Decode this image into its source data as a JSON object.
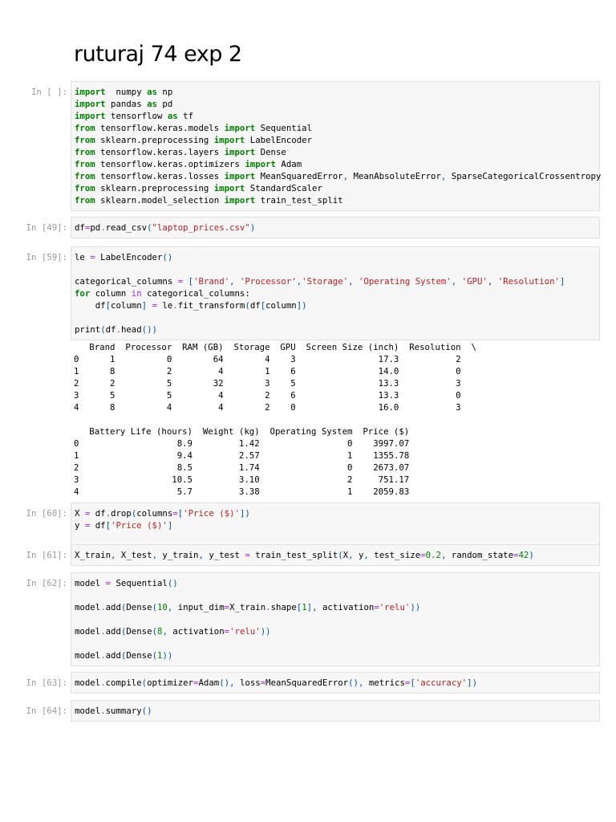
{
  "title": "ruturaj 74 exp 2",
  "cells": [
    {
      "prompt": "In [ ]:",
      "code": [
        [
          [
            "k",
            "import"
          ],
          [
            "",
            "  numpy "
          ],
          [
            "k",
            "as"
          ],
          [
            "",
            " np"
          ]
        ],
        [
          [
            "k",
            "import"
          ],
          [
            "",
            " pandas "
          ],
          [
            "k",
            "as"
          ],
          [
            "",
            " pd"
          ]
        ],
        [
          [
            "k",
            "import"
          ],
          [
            "",
            " tensorflow "
          ],
          [
            "k",
            "as"
          ],
          [
            "",
            " tf"
          ]
        ],
        [
          [
            "k",
            "from"
          ],
          [
            "",
            " tensorflow.keras.models "
          ],
          [
            "k",
            "import"
          ],
          [
            "",
            " Sequential"
          ]
        ],
        [
          [
            "k",
            "from"
          ],
          [
            "",
            " sklearn.preprocessing "
          ],
          [
            "k",
            "import"
          ],
          [
            "",
            " LabelEncoder"
          ]
        ],
        [
          [
            "k",
            "from"
          ],
          [
            "",
            " tensorflow.keras.layers "
          ],
          [
            "k",
            "import"
          ],
          [
            "",
            " Dense"
          ]
        ],
        [
          [
            "k",
            "from"
          ],
          [
            "",
            " tensorflow.keras.optimizers "
          ],
          [
            "k",
            "import"
          ],
          [
            "",
            " Adam"
          ]
        ],
        [
          [
            "k",
            "from"
          ],
          [
            "",
            " tensorflow.keras.losses "
          ],
          [
            "k",
            "import"
          ],
          [
            "",
            " MeanSquaredError"
          ],
          [
            "p",
            ","
          ],
          [
            "",
            " MeanAbsoluteError"
          ],
          [
            "p",
            ","
          ],
          [
            "",
            " SparseCategoricalCrossentropy"
          ]
        ],
        [
          [
            "k",
            "from"
          ],
          [
            "",
            " sklearn.preprocessing "
          ],
          [
            "k",
            "import"
          ],
          [
            "",
            " StandardScaler"
          ]
        ],
        [
          [
            "k",
            "from"
          ],
          [
            "",
            " sklearn.model_selection "
          ],
          [
            "k",
            "import"
          ],
          [
            "",
            " train_test_split"
          ]
        ]
      ]
    },
    {
      "prompt": "In [49]:",
      "code": [
        [
          [
            "",
            "df"
          ],
          [
            "o",
            "="
          ],
          [
            "",
            "pd"
          ],
          [
            "o",
            "."
          ],
          [
            "",
            "read_csv"
          ],
          [
            "p",
            "("
          ],
          [
            "s",
            "\"laptop_prices.csv\""
          ],
          [
            "p",
            ")"
          ]
        ]
      ]
    },
    {
      "prompt": "In [59]:",
      "code": [
        [
          [
            "",
            "le "
          ],
          [
            "o",
            "="
          ],
          [
            "",
            " LabelEncoder"
          ],
          [
            "p",
            "()"
          ]
        ],
        [],
        [
          [
            "",
            "categorical_columns "
          ],
          [
            "o",
            "="
          ],
          [
            "p",
            " ["
          ],
          [
            "s",
            "'Brand'"
          ],
          [
            "p",
            ", "
          ],
          [
            "s",
            "'Processor'"
          ],
          [
            "p",
            ","
          ],
          [
            "s",
            "'Storage'"
          ],
          [
            "p",
            ", "
          ],
          [
            "s",
            "'Operating System'"
          ],
          [
            "p",
            ", "
          ],
          [
            "s",
            "'GPU'"
          ],
          [
            "p",
            ", "
          ],
          [
            "s",
            "'Resolution'"
          ],
          [
            "p",
            "]"
          ]
        ],
        [
          [
            "k",
            "for"
          ],
          [
            "",
            " column "
          ],
          [
            "o",
            "in"
          ],
          [
            "",
            " categorical_columns:"
          ]
        ],
        [
          [
            "",
            "    df"
          ],
          [
            "p",
            "["
          ],
          [
            "",
            "column"
          ],
          [
            "p",
            "]"
          ],
          [
            "o",
            " ="
          ],
          [
            "",
            " le"
          ],
          [
            "o",
            "."
          ],
          [
            "",
            "fit_transform"
          ],
          [
            "p",
            "("
          ],
          [
            "",
            "df"
          ],
          [
            "p",
            "["
          ],
          [
            "",
            "column"
          ],
          [
            "p",
            "])"
          ]
        ],
        [],
        [
          [
            "",
            "print"
          ],
          [
            "p",
            "("
          ],
          [
            "",
            "df"
          ],
          [
            "o",
            "."
          ],
          [
            "",
            "head"
          ],
          [
            "p",
            "())"
          ]
        ]
      ],
      "output": [
        "   Brand  Processor  RAM (GB)  Storage  GPU  Screen Size (inch)  Resolution  \\",
        "0      1          0        64        4    3                17.3           2",
        "1      8          2         4        1    6                14.0           0",
        "2      2          5        32        3    5                13.3           3",
        "3      5          5         4        2    6                13.3           0",
        "4      8          4         4        2    0                16.0           3",
        "",
        "   Battery Life (hours)  Weight (kg)  Operating System  Price ($)",
        "0                   8.9         1.42                 0    3997.07",
        "1                   9.4         2.57                 1    1355.78",
        "2                   8.5         1.74                 0    2673.07",
        "3                  10.5         3.10                 2     751.17",
        "4                   5.7         3.38                 1    2059.83"
      ]
    },
    {
      "prompt": "In [60]:",
      "code": [
        [
          [
            "",
            "X "
          ],
          [
            "o",
            "="
          ],
          [
            "",
            " df"
          ],
          [
            "o",
            "."
          ],
          [
            "",
            "drop"
          ],
          [
            "p",
            "("
          ],
          [
            "",
            "columns"
          ],
          [
            "o",
            "="
          ],
          [
            "p",
            "["
          ],
          [
            "s",
            "'Price ($)'"
          ],
          [
            "p",
            "])"
          ]
        ],
        [
          [
            "",
            "y "
          ],
          [
            "o",
            "="
          ],
          [
            "",
            " df"
          ],
          [
            "p",
            "["
          ],
          [
            "s",
            "'Price ($)'"
          ],
          [
            "p",
            "]"
          ]
        ],
        []
      ]
    },
    {
      "prompt": "In [61]:",
      "code": [
        [
          [
            "",
            "X_train"
          ],
          [
            "p",
            ","
          ],
          [
            "",
            " X_test"
          ],
          [
            "p",
            ","
          ],
          [
            "",
            " y_train"
          ],
          [
            "p",
            ","
          ],
          [
            "",
            " y_test "
          ],
          [
            "o",
            "="
          ],
          [
            "",
            " train_test_split"
          ],
          [
            "p",
            "("
          ],
          [
            "",
            "X"
          ],
          [
            "p",
            ","
          ],
          [
            "",
            " y"
          ],
          [
            "p",
            ","
          ],
          [
            "",
            " test_size"
          ],
          [
            "o",
            "="
          ],
          [
            "n",
            "0.2"
          ],
          [
            "p",
            ","
          ],
          [
            "",
            " random_state"
          ],
          [
            "o",
            "="
          ],
          [
            "n",
            "42"
          ],
          [
            "p",
            ")"
          ]
        ]
      ]
    },
    {
      "prompt": "In [62]:",
      "code": [
        [
          [
            "",
            "model "
          ],
          [
            "o",
            "="
          ],
          [
            "",
            " Sequential"
          ],
          [
            "p",
            "()"
          ]
        ],
        [],
        [
          [
            "",
            "model"
          ],
          [
            "o",
            "."
          ],
          [
            "",
            "add"
          ],
          [
            "p",
            "("
          ],
          [
            "",
            "Dense"
          ],
          [
            "p",
            "("
          ],
          [
            "n",
            "10"
          ],
          [
            "p",
            ","
          ],
          [
            "",
            " input_dim"
          ],
          [
            "o",
            "="
          ],
          [
            "",
            "X_train"
          ],
          [
            "o",
            "."
          ],
          [
            "",
            "shape"
          ],
          [
            "p",
            "["
          ],
          [
            "n",
            "1"
          ],
          [
            "p",
            "],"
          ],
          [
            "",
            " activation"
          ],
          [
            "o",
            "="
          ],
          [
            "s",
            "'relu'"
          ],
          [
            "p",
            "))"
          ]
        ],
        [],
        [
          [
            "",
            "model"
          ],
          [
            "o",
            "."
          ],
          [
            "",
            "add"
          ],
          [
            "p",
            "("
          ],
          [
            "",
            "Dense"
          ],
          [
            "p",
            "("
          ],
          [
            "n",
            "8"
          ],
          [
            "p",
            ","
          ],
          [
            "",
            " activation"
          ],
          [
            "o",
            "="
          ],
          [
            "s",
            "'relu'"
          ],
          [
            "p",
            "))"
          ]
        ],
        [],
        [
          [
            "",
            "model"
          ],
          [
            "o",
            "."
          ],
          [
            "",
            "add"
          ],
          [
            "p",
            "("
          ],
          [
            "",
            "Dense"
          ],
          [
            "p",
            "("
          ],
          [
            "n",
            "1"
          ],
          [
            "p",
            "))"
          ]
        ]
      ]
    },
    {
      "prompt": "In [63]:",
      "code": [
        [
          [
            "",
            "model"
          ],
          [
            "o",
            "."
          ],
          [
            "",
            "compile"
          ],
          [
            "p",
            "("
          ],
          [
            "",
            "optimizer"
          ],
          [
            "o",
            "="
          ],
          [
            "",
            "Adam"
          ],
          [
            "p",
            "(),"
          ],
          [
            "",
            " loss"
          ],
          [
            "o",
            "="
          ],
          [
            "",
            "MeanSquaredError"
          ],
          [
            "p",
            "(),"
          ],
          [
            "",
            " metrics"
          ],
          [
            "o",
            "="
          ],
          [
            "p",
            "["
          ],
          [
            "s",
            "'accuracy'"
          ],
          [
            "p",
            "])"
          ]
        ]
      ]
    },
    {
      "prompt": "In [64]:",
      "code": [
        [
          [
            "",
            "model"
          ],
          [
            "o",
            "."
          ],
          [
            "",
            "summary"
          ],
          [
            "p",
            "()"
          ]
        ]
      ]
    }
  ]
}
